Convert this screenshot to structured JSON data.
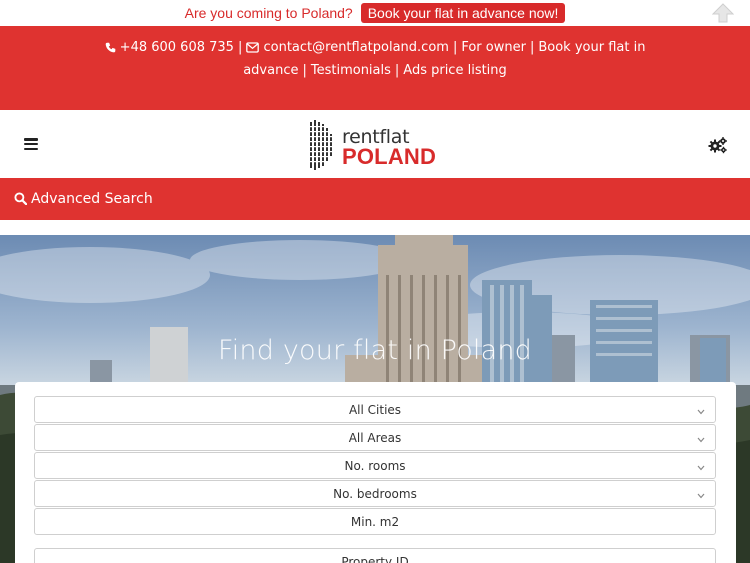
{
  "promo": {
    "text": "Are you coming to Poland?",
    "button_label": "Book your flat in advance now!"
  },
  "contact": {
    "phone": "+48 600 608 735",
    "email": "contact@rentflatpoland.com",
    "links": [
      "For owner",
      "Book your flat in advance",
      "Testimonials",
      "Ads price listing"
    ]
  },
  "logo": {
    "top": "rentflat",
    "bottom": "POLAND"
  },
  "advanced_search": {
    "label": "Advanced Search"
  },
  "hero": {
    "title": "Find your flat in Poland"
  },
  "search_form": {
    "city": "All Cities",
    "area": "All Areas",
    "rooms": "No. rooms",
    "bedrooms": "No. bedrooms",
    "min_m2": "Min. m2",
    "property_id": "Property ID"
  },
  "colors": {
    "brand_red": "#df3330",
    "text_dark": "#333333"
  },
  "icons": [
    "phone-icon",
    "envelope-icon",
    "menu-icon",
    "settings-icon",
    "search-icon",
    "scroll-top-icon",
    "chevron-down-icon"
  ]
}
